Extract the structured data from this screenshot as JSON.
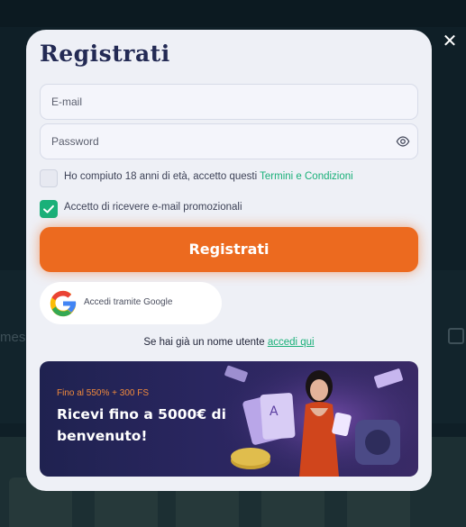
{
  "modal": {
    "title": "Registrati",
    "email_placeholder": "E-mail",
    "password_placeholder": "Password",
    "age_text": "Ho compiuto 18 anni di età, accetto questi ",
    "terms_link": "Termini e Condizioni",
    "age_checked": false,
    "promo_optin_text": "Accetto di ricevere e-mail promozionali",
    "promo_optin_checked": true,
    "submit_label": "Registrati",
    "google_label": "Accedi tramite Google",
    "login_prompt": "Se hai già un nome utente ",
    "login_link": "accedi qui"
  },
  "promo": {
    "subtitle": "Fino al 550% + 300 FS",
    "headline": "Ricevi fino a 5000€ di benvenuto!"
  },
  "background": {
    "partial_text": "mes"
  },
  "icons": {
    "close": "close-icon",
    "eye": "eye-icon",
    "check": "check-icon",
    "google": "google-icon"
  },
  "colors": {
    "accent_orange": "#ec6a1f",
    "accent_green": "#1ab079",
    "title_navy": "#232a54",
    "modal_bg": "#eef0f6"
  }
}
